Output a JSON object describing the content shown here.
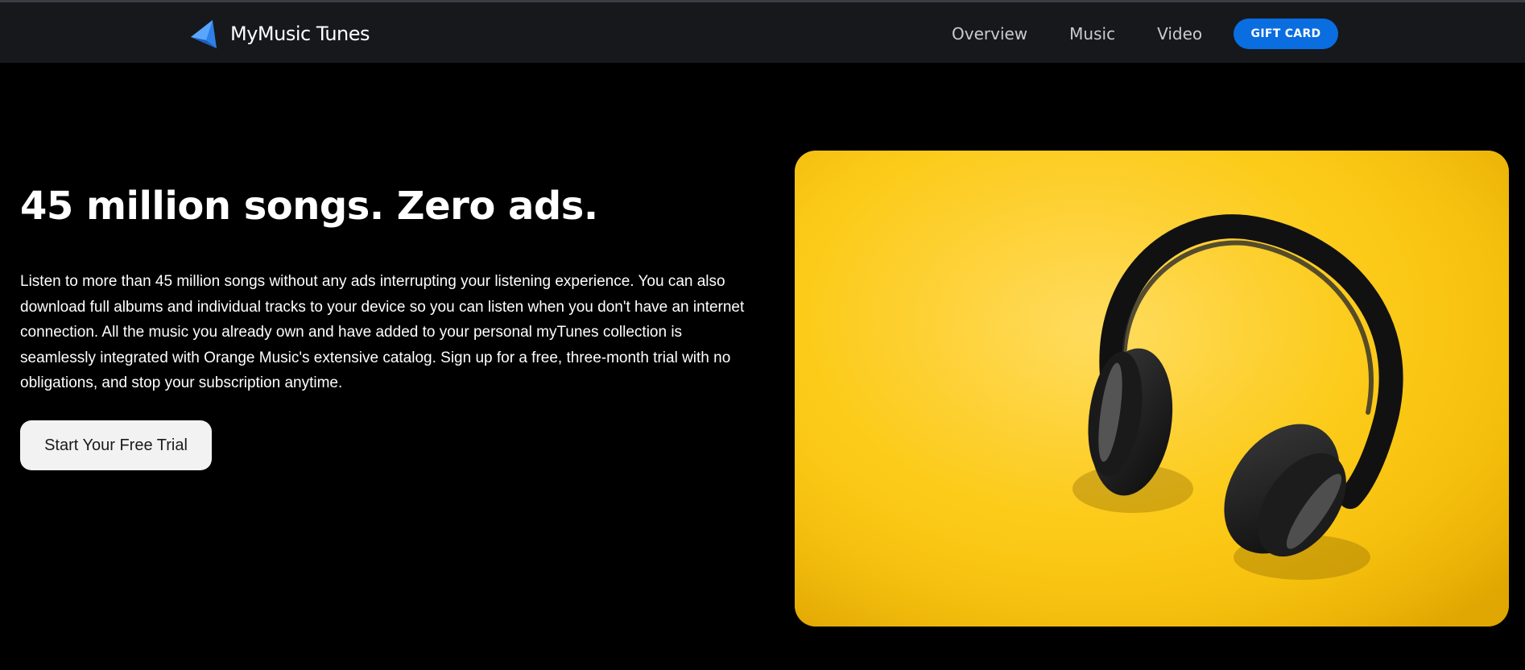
{
  "brand": {
    "name": "MyMusic Tunes",
    "logo_icon": "triangle-logo-icon",
    "logo_color": "#3b8ff0"
  },
  "nav": {
    "links": [
      "Overview",
      "Music",
      "Video"
    ],
    "gift_card_label": "GIFT CARD",
    "gift_card_color": "#0a6de0"
  },
  "hero": {
    "title": "45 million songs. Zero ads.",
    "description": "Listen to more than 45 million songs without any ads interrupting your listening experience. You can also download full albums and individual tracks to your device so you can listen when you don't have an internet connection. All the music you already own and have added to your personal myTunes collection is seamlessly integrated with Orange Music's extensive catalog. Sign up for a free, three-month trial with no obligations, and stop your subscription anytime.",
    "cta_label": "Start Your Free Trial",
    "image_subject": "headphones-on-yellow-background",
    "image_bg_color": "#fccb1a"
  }
}
